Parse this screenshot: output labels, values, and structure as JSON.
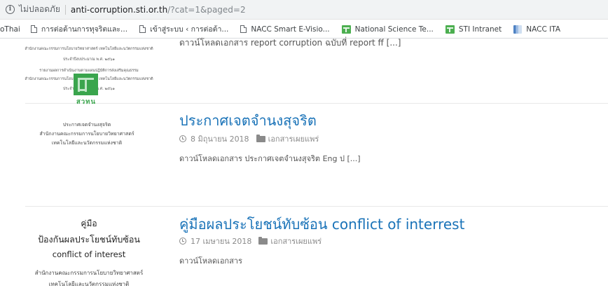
{
  "browser": {
    "security_label": "ไม่ปลอดภัย",
    "url_host": "anti-corruption.sti.or.th",
    "url_path": "/?cat=1&paged=2",
    "bookmarks": [
      {
        "label": "oThai",
        "icon": "none"
      },
      {
        "label": "การต่อต้านการทุจริตและ...",
        "icon": "page-icon"
      },
      {
        "label": "เข้าสู่ระบบ ‹ การต่อต้า...",
        "icon": "page-icon"
      },
      {
        "label": "NACC Smart E-Visio...",
        "icon": "page-icon"
      },
      {
        "label": "National Science Te...",
        "icon": "sti-icon"
      },
      {
        "label": "STI Intranet",
        "icon": "sti-icon"
      },
      {
        "label": "NACC ITA",
        "icon": "nacc-icon"
      }
    ]
  },
  "partial_post": {
    "thumb_lines": [
      "สำนักงานคณะกรรมการนโยบายวิทยาศาสตร์ เทคโนโลยีและนวัตกรรมแห่งชาติ",
      "ประจำปีงบประมาณ พ.ศ. ๒๕๖๑",
      "รายงานผลการดำเนินงานตามแผนปฏิบัติการส่งเสริมคุณธรรม",
      "สำนักงานคณะกรรมการนโยบายวิทยาศาสตร์ เทคโนโลยีและนวัตกรรมแห่งชาติ",
      "ประจำปีงบประมาณ พ.ศ. ๒๕๖๑"
    ],
    "excerpt": "ดาวน์โหลดเอกสาร report corruption ฉบับที่ report ff [...]"
  },
  "posts": [
    {
      "title": "ประกาศเจตจำนงสุจริต",
      "date": "8 มิถุนายน 2018",
      "category": "เอกสารเผยแพร่",
      "excerpt": "ดาวน์โหลดเอกสาร     ประกาศเจตจำนงสุจริต Eng ป [...]",
      "thumb": {
        "logo_caption": "สวทน",
        "lines": [
          "ประกาศเจตจำนงสุจริต",
          "สำนักงานคณะกรรมการนโยบายวิทยาศาสตร์",
          "เทคโนโลยีและนวัตกรรมแห่งชาติ"
        ]
      }
    },
    {
      "title": "คู่มือผลประโยชน์ทับซ้อน conflict of interrest",
      "date": "17 เมษายน 2018",
      "category": "เอกสารเผยแพร่",
      "excerpt": "ดาวน์โหลดเอกสาร",
      "thumb": {
        "lines": [
          "คู่มือ",
          "ป้องกันผลประโยชน์ทับซ้อน",
          "conflict of interest",
          "สำนักงานคณะกรรมการนโยบายวิทยาศาสตร์",
          "เทคโนโลยีและนวัตกรรมแห่งชาติ"
        ]
      }
    }
  ]
}
